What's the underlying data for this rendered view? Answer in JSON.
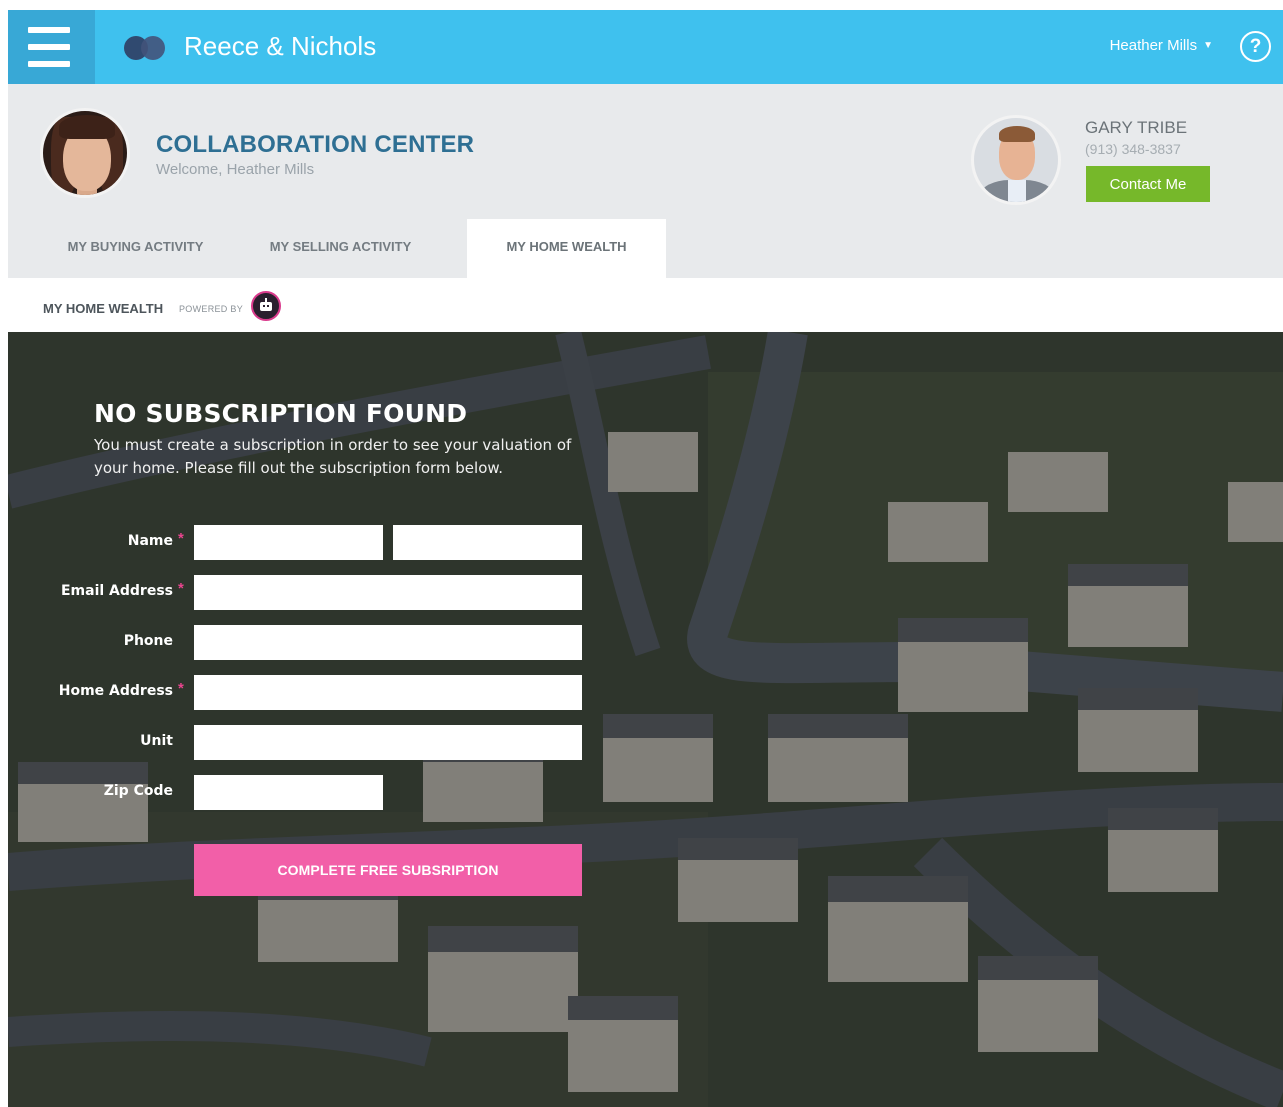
{
  "topbar": {
    "brand": "Reece & Nichols",
    "user_name": "Heather Mills",
    "user_caret": "▼",
    "help_label": "?",
    "colors": {
      "bar": "#3fc1ee",
      "menu": "#38a8d6"
    }
  },
  "header": {
    "title": "COLLABORATION CENTER",
    "welcome": "Welcome, Heather Mills",
    "agent": {
      "name": "GARY TRIBE",
      "phone": "(913) 348-3837",
      "contact_label": "Contact Me"
    },
    "tabs": [
      {
        "label": "MY BUYING ACTIVITY",
        "active": false
      },
      {
        "label": "MY SELLING ACTIVITY",
        "active": false
      },
      {
        "label": "MY HOME WEALTH",
        "active": true
      }
    ]
  },
  "subheader": {
    "title": "MY HOME WEALTH",
    "powered_by": "POWERED BY",
    "bot_icon": "robot-icon"
  },
  "form": {
    "title": "NO SUBSCRIPTION FOUND",
    "description": "You must create a subscription in order to see your valuation of your home.  Please fill out the subscription form below.",
    "required_marker": "*",
    "fields": {
      "name": {
        "label": "Name",
        "required": true,
        "first_value": "",
        "last_value": ""
      },
      "email": {
        "label": "Email Address",
        "required": true,
        "value": ""
      },
      "phone": {
        "label": "Phone",
        "required": false,
        "value": ""
      },
      "home_address": {
        "label": "Home Address",
        "required": true,
        "value": ""
      },
      "unit": {
        "label": "Unit",
        "required": false,
        "value": ""
      },
      "zip": {
        "label": "Zip Code",
        "required": false,
        "value": ""
      }
    },
    "submit_label": "COMPLETE FREE SUBSRIPTION",
    "colors": {
      "submit": "#f25fa8",
      "required": "#e8458e"
    }
  }
}
